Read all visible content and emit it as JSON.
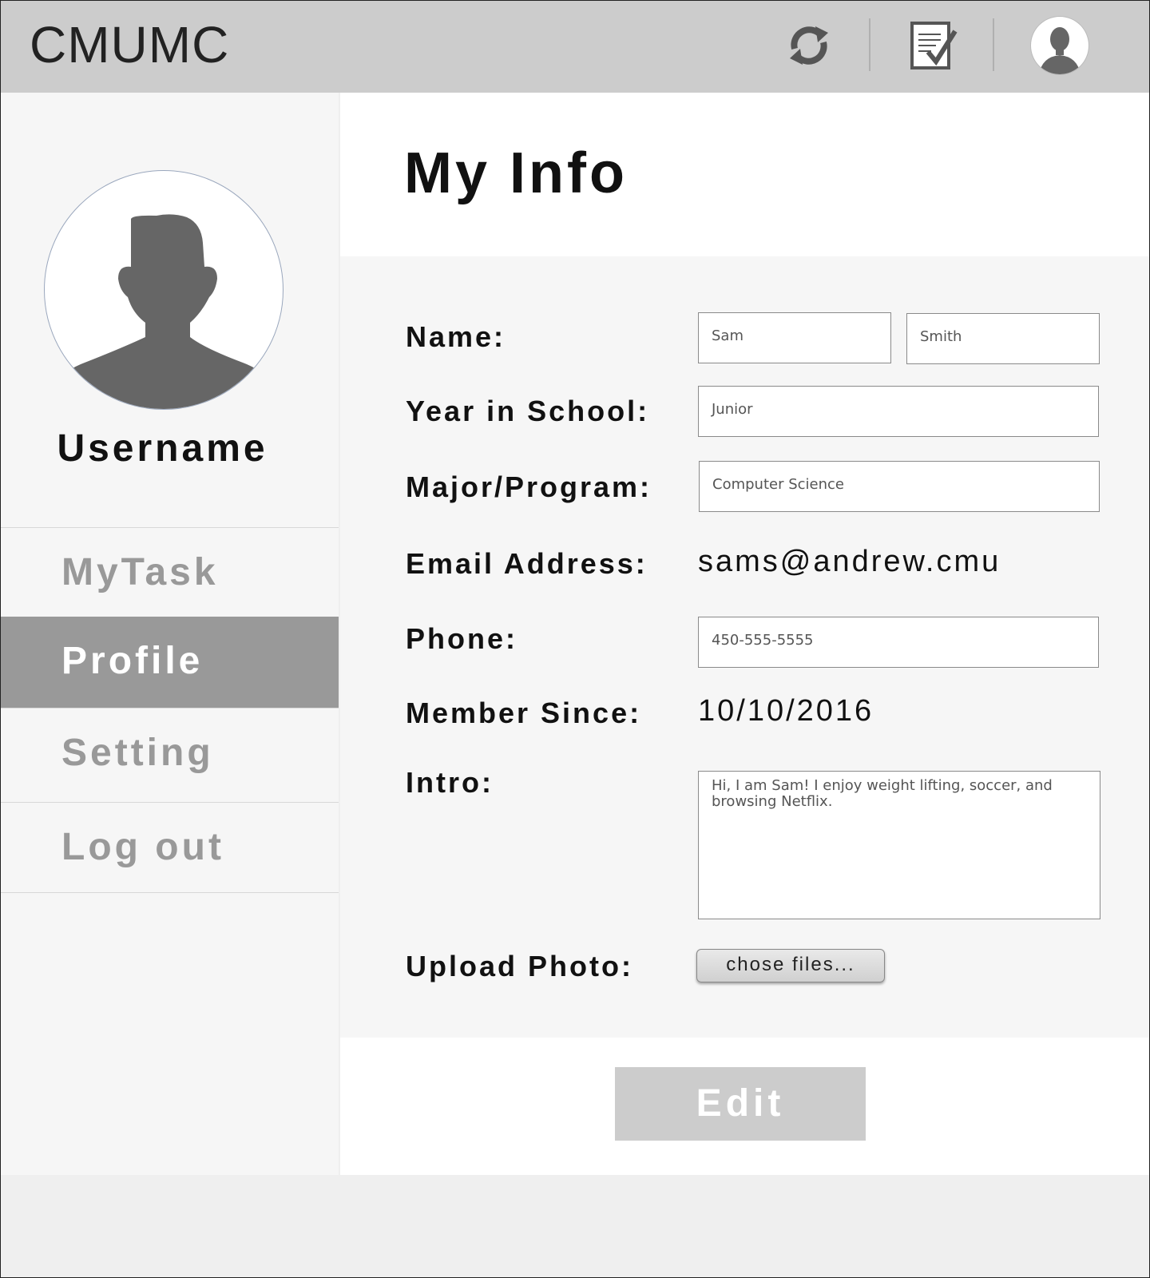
{
  "app": {
    "brand": "CMUMC"
  },
  "header": {
    "icons": [
      "sync-icon",
      "task-checklist-icon",
      "user-avatar-icon"
    ]
  },
  "sidebar": {
    "username": "Username",
    "items": [
      {
        "label": "MyTask",
        "active": false
      },
      {
        "label": "Profile",
        "active": true
      },
      {
        "label": "Setting",
        "active": false
      },
      {
        "label": "Log out",
        "active": false
      }
    ]
  },
  "main": {
    "title": "My Info",
    "labels": {
      "name": "Name:",
      "year": "Year in School:",
      "major": "Major/Program:",
      "email": "Email Address:",
      "phone": "Phone:",
      "member_since": "Member Since:",
      "intro": "Intro:",
      "upload": "Upload Photo:"
    },
    "values": {
      "first_name": "Sam",
      "last_name": "Smith",
      "year": "Junior",
      "major": "Computer Science",
      "email": "sams@andrew.cmu",
      "phone": "450-555-5555",
      "member_since": "10/10/2016",
      "intro": "Hi, I am Sam! I enjoy weight lifting, soccer, and browsing Netflix."
    },
    "upload_button": "chose files...",
    "edit_button": "Edit"
  },
  "colors": {
    "header_bg": "#cccccc",
    "sidebar_bg": "#f6f6f6",
    "active_nav_bg": "#999999",
    "edit_button_bg": "#cccccc"
  }
}
